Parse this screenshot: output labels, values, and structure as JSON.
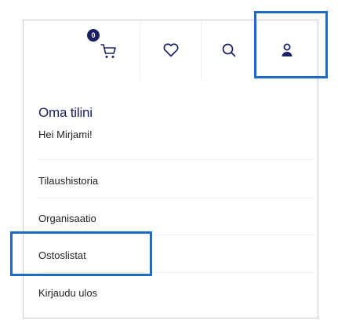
{
  "header": {
    "cart_count": "0",
    "icons": [
      "cart-icon",
      "heart-icon",
      "search-icon",
      "user-icon"
    ]
  },
  "account": {
    "title": "Oma tilini",
    "greeting": "Hei Mirjami!"
  },
  "menu": {
    "items": [
      {
        "label": "Tilaushistoria"
      },
      {
        "label": "Organisaatio"
      },
      {
        "label": "Ostoslistat"
      },
      {
        "label": "Kirjaudu ulos"
      }
    ]
  },
  "colors": {
    "brand": "#1b2160",
    "focus": "#1a6dc1",
    "border": "#c9ccd6"
  }
}
